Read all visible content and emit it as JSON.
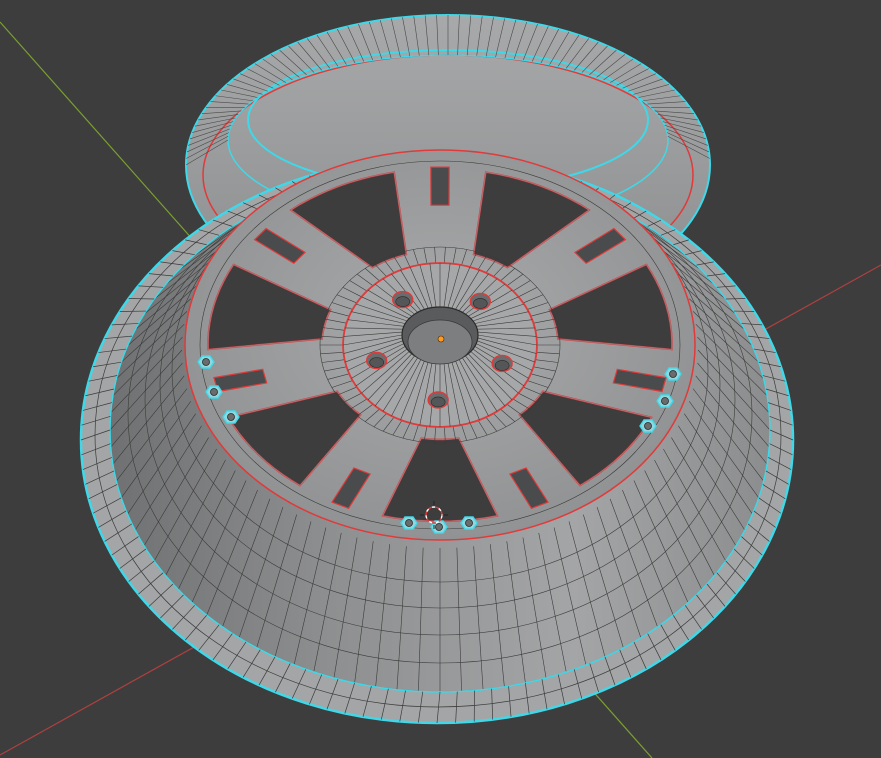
{
  "viewport": {
    "background": "#3d3d3d",
    "axis_x_color": "#b04040",
    "axis_y_color": "#7aa030",
    "mesh_fill": "#999a9b",
    "mesh_dark": "#6e6f70",
    "wire_color": "#2a2a2a",
    "seam_color": "#e03a3a",
    "sharp_edge_color": "#3fd8e8",
    "origin_color": "#ff9a20"
  },
  "scene": {
    "object": "wheel-rim",
    "spoke_count": 7,
    "lug_holes": 5,
    "bolt_count": 9,
    "icons": [
      "3d-cursor-icon",
      "origin-point-icon"
    ]
  }
}
